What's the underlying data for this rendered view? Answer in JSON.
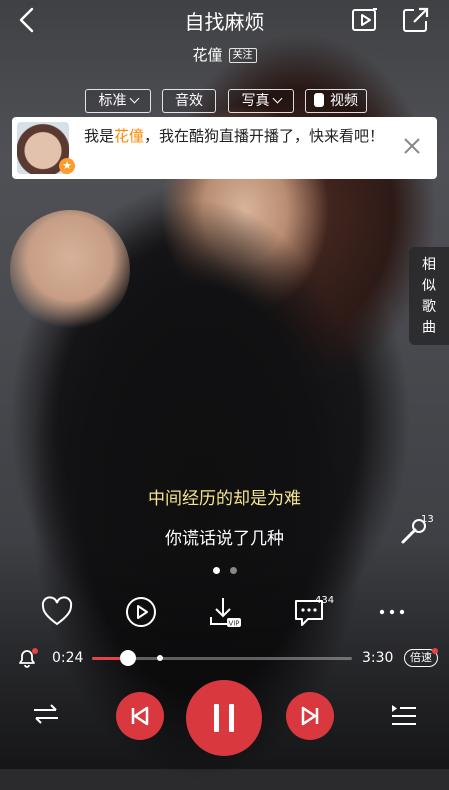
{
  "header": {
    "song_title": "自找麻烦",
    "singer": "花僮",
    "follow_label": "关注"
  },
  "tabs": [
    {
      "label": "标准",
      "has_dropdown": true
    },
    {
      "label": "音效",
      "has_dropdown": false
    },
    {
      "label": "写真",
      "has_dropdown": true
    },
    {
      "label": "视频",
      "has_dropdown": false
    }
  ],
  "notification": {
    "text_before": "我是",
    "highlight": "花僮",
    "text_after": "，我在酷狗直播开播了，快来看吧！"
  },
  "side_panel": {
    "label_chars": [
      "相",
      "似",
      "歌",
      "曲"
    ]
  },
  "lyrics": {
    "current": "中间经历的却是为难",
    "next": "你谎话说了几种"
  },
  "mic_count": "13",
  "comment_count": "434",
  "player": {
    "current_time": "0:24",
    "total_time": "3:30",
    "progress_fraction": 0.1375,
    "buffered_fraction": 0.26,
    "speed_label": "倍速"
  },
  "colors": {
    "accent": "#d9383f",
    "lyric_highlight": "#f6e58d",
    "notification_highlight": "#ff8a00"
  },
  "icons": [
    "back-icon",
    "mv-icon",
    "share-icon",
    "heart-icon",
    "play-circle-icon",
    "download-vip-icon",
    "comment-icon",
    "more-icon",
    "bell-icon",
    "shuffle-icon",
    "previous-icon",
    "pause-icon",
    "next-icon",
    "playlist-icon",
    "mic-icon",
    "close-icon"
  ]
}
